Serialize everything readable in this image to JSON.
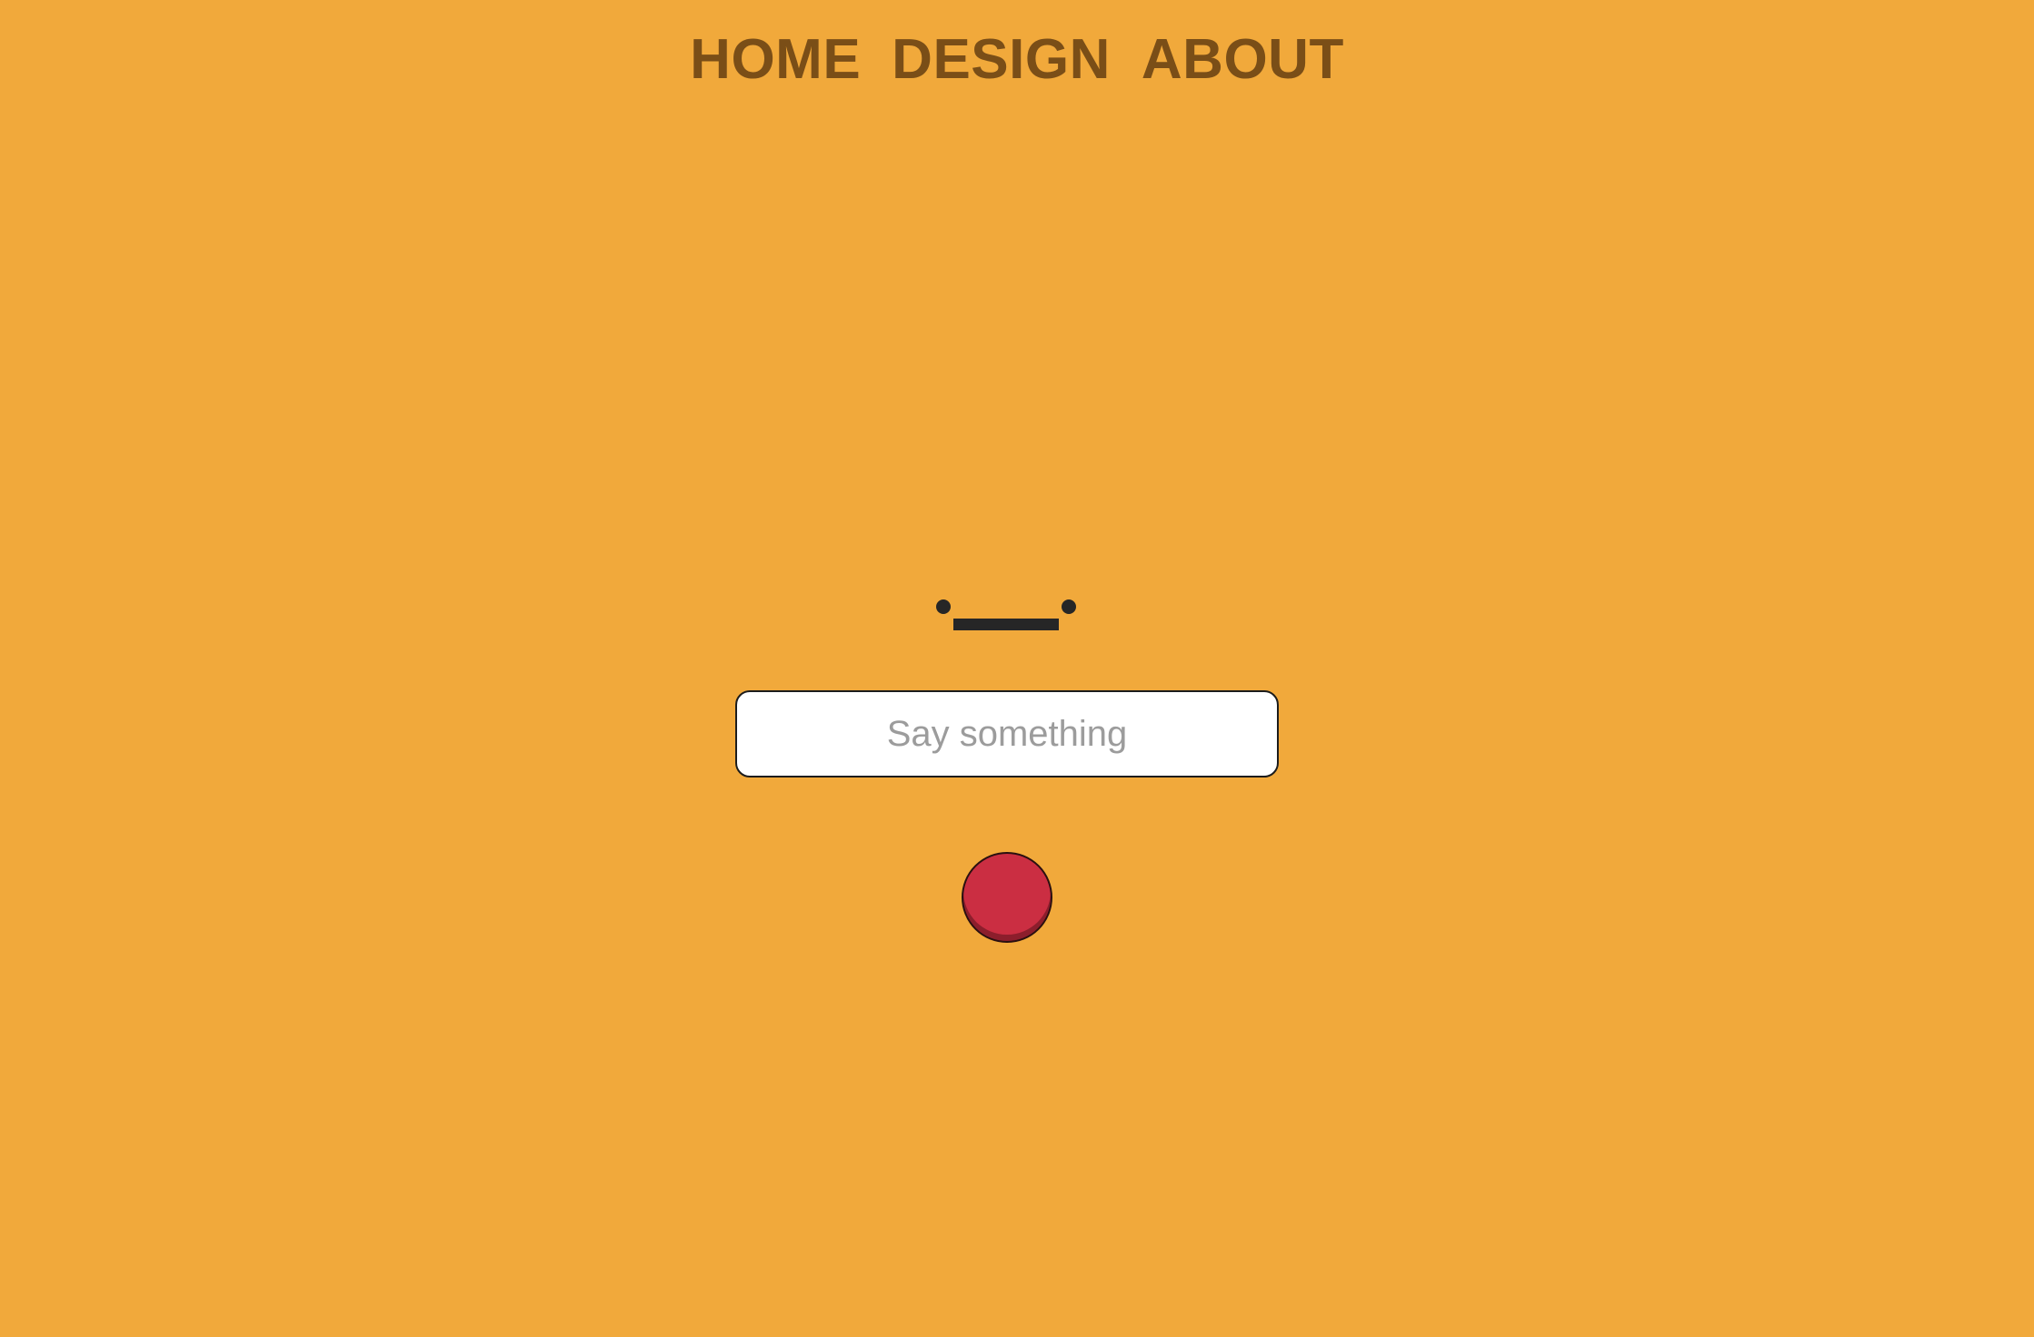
{
  "nav": {
    "home": "HOME",
    "design": "DESIGN",
    "about": "ABOUT"
  },
  "face": {
    "expression": "neutral-face"
  },
  "input": {
    "value": "",
    "placeholder": "Say something"
  },
  "record_button": {
    "icon": "record-icon"
  },
  "colors": {
    "background": "#f1a93b",
    "nav_text": "#7a4e17",
    "face": "#262626",
    "button": "#cb2e42",
    "button_shade": "#8c1e2c",
    "placeholder": "#9c9c9c"
  }
}
